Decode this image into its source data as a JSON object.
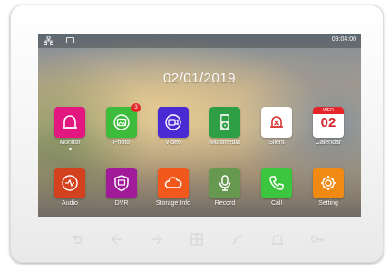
{
  "status": {
    "time": "09:04:00"
  },
  "home": {
    "date": "02/01/2019"
  },
  "apps_row1": [
    {
      "label": "Monitor",
      "color": "#e2177f",
      "icon": "bell-icon"
    },
    {
      "label": "Photo",
      "color": "#3dbb3a",
      "icon": "photo-icon",
      "badge": "3"
    },
    {
      "label": "Video",
      "color": "#4a2bd3",
      "icon": "video-icon"
    },
    {
      "label": "Multimedia",
      "color": "#2e9f45",
      "icon": "ipod-icon"
    },
    {
      "label": "Silent",
      "color": "#ffffff",
      "icon": "silent-bell-icon"
    },
    {
      "label": "Calendar",
      "color": "#ffffff",
      "icon": "calendar-icon",
      "cal_month": "WED",
      "cal_day": "02"
    }
  ],
  "apps_row2": [
    {
      "label": "Audio",
      "color": "#d4411f",
      "icon": "audio-icon"
    },
    {
      "label": "DVR",
      "color": "#a01a9a",
      "icon": "shield-icon"
    },
    {
      "label": "Storage Info",
      "color": "#f2581b",
      "icon": "cloud-icon"
    },
    {
      "label": "Record",
      "color": "#67984f",
      "icon": "microphone-icon"
    },
    {
      "label": "Call",
      "color": "#3cc63f",
      "icon": "phone-icon"
    },
    {
      "label": "Setting",
      "color": "#f08a12",
      "icon": "gear-icon"
    }
  ],
  "touch_keys": [
    "back-icon",
    "arrow-left-icon",
    "arrow-right-icon",
    "grid-icon",
    "handset-icon",
    "bell-outline-icon",
    "key-icon"
  ]
}
